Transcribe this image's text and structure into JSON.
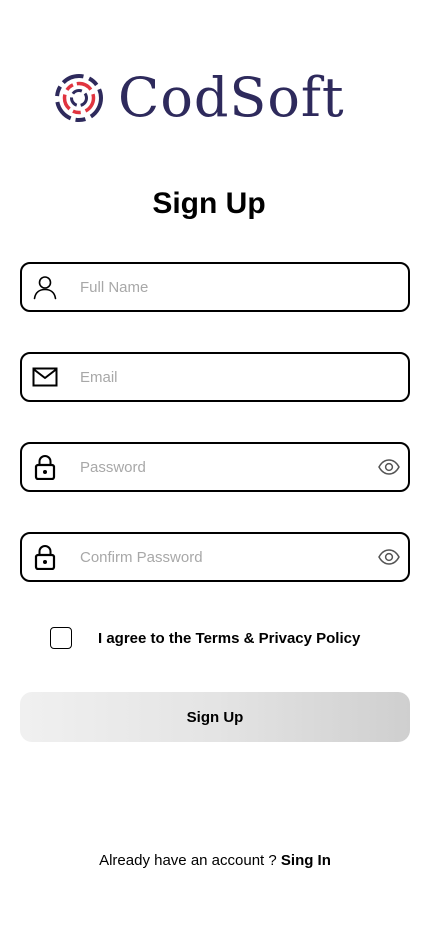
{
  "brand": {
    "name": "CodSoft",
    "logo_icon": "concentric-rings-logo-icon",
    "colors": {
      "navy": "#2e2a5c",
      "red": "#e0343f"
    }
  },
  "page": {
    "title": "Sign Up"
  },
  "form": {
    "full_name": {
      "placeholder": "Full Name",
      "icon": "user-icon"
    },
    "email": {
      "placeholder": "Email",
      "icon": "envelope-icon"
    },
    "password": {
      "placeholder": "Password",
      "icon": "lock-icon",
      "toggle_icon": "eye-icon"
    },
    "confirm_password": {
      "placeholder": "Confirm Password",
      "icon": "lock-icon",
      "toggle_icon": "eye-icon"
    },
    "agree_label": "I agree to the Terms & Privacy Policy",
    "agree_checked": false,
    "submit_label": "Sign Up"
  },
  "footer": {
    "prompt": "Already have an account ? ",
    "link_label": "Sing In"
  }
}
